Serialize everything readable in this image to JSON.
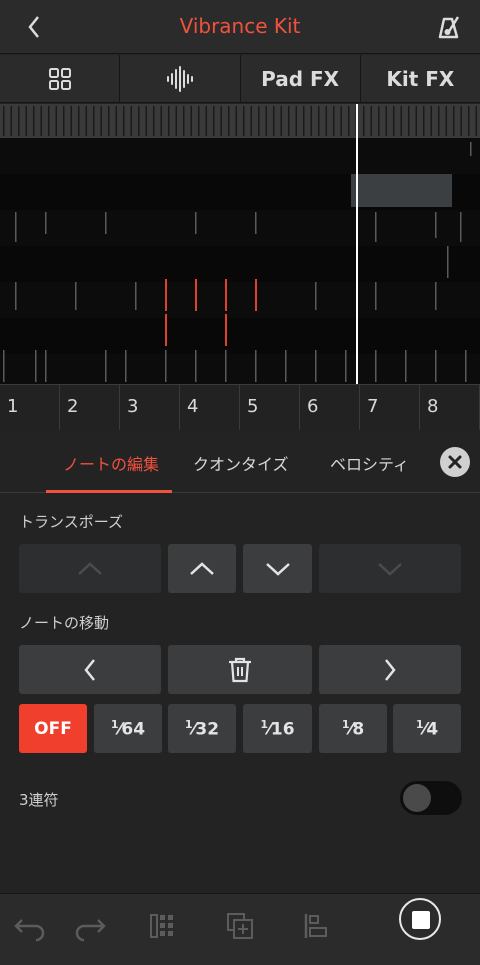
{
  "header": {
    "title": "Vibrance Kit",
    "back_icon": "chevron-left-icon",
    "right_icon": "metronome-icon"
  },
  "tabs": [
    {
      "icon": "grid-icon",
      "label": ""
    },
    {
      "icon": "waveform-icon",
      "label": ""
    },
    {
      "icon": "",
      "label": "Pad FX"
    },
    {
      "icon": "",
      "label": "Kit FX"
    }
  ],
  "bars": [
    "1",
    "2",
    "3",
    "4",
    "5",
    "6",
    "7",
    "8"
  ],
  "subtabs": {
    "edit": "ノートの編集",
    "quantize": "クオンタイズ",
    "velocity": "ベロシティ"
  },
  "transpose": {
    "label": "トランスポーズ"
  },
  "move": {
    "label": "ノートの移動"
  },
  "quantize_values": {
    "off": "OFF",
    "n64": "64",
    "n32": "32",
    "n16": "16",
    "n8": "8",
    "n4": "4",
    "one": "1"
  },
  "triplet": {
    "label": "3連符",
    "enabled": false
  },
  "colors": {
    "accent": "#f0523e",
    "background": "#232323",
    "button": "#3b3d3e"
  }
}
